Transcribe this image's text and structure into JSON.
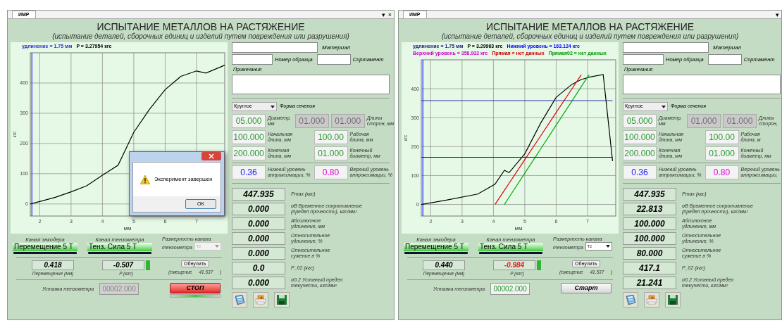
{
  "windows": [
    {
      "tab": "ИМР",
      "tab_buttons": [
        "▾",
        "×"
      ],
      "title": "ИСПЫТАНИЕ МЕТАЛЛОВ НА РАСТЯЖЕНИЕ",
      "subtitle": "(испытание деталей, сборочных единиц и изделий путем повреждения или разрушения)",
      "chart": {
        "legend_rows": [
          {
            "items": [
              {
                "text": "удлинение = 1.75 мм",
                "color": "#3030d0"
              },
              {
                "text": "P = 3.27954 кгс",
                "color": "#000000"
              }
            ]
          }
        ],
        "chart_data": {
          "type": "line",
          "xlabel": "мм",
          "ylabel": "кгс",
          "xlim": [
            1.7,
            7.9
          ],
          "ylim": [
            -40,
            500
          ],
          "xticks": [
            2,
            3,
            4,
            5,
            6,
            7
          ],
          "yticks": [
            0,
            100,
            200,
            300,
            400
          ],
          "x": [
            1.7,
            2,
            2.5,
            3,
            3.5,
            4,
            4.5,
            5,
            5.5,
            6,
            6.5,
            7,
            7.3,
            7.9
          ],
          "grid": true,
          "ref_lines": [
            {
              "axis": "x",
              "value": 1.75,
              "color": "#2020ff"
            }
          ],
          "series": [
            {
              "color": "#000000",
              "values": [
                0,
                8,
                22,
                40,
                60,
                95,
                128,
                237,
                313,
                378,
                422,
                440,
                433,
                459
              ]
            }
          ]
        },
        "dialog": {
          "message": "Эксперимент завершен",
          "button": "OK"
        }
      },
      "form": {
        "material_label": "Материал",
        "sample_label": "Номер образца",
        "sortament_label": "Сортамент",
        "notes_label": "Примечания",
        "section_value": "Круглое",
        "section_label": "Форма сечения",
        "params": [
          {
            "items": [
              {
                "kind": "field",
                "value": "05.000",
                "color": "#22992a",
                "disabled": false
              },
              {
                "kind": "label",
                "lines": [
                  "Диаметр,",
                  "мм"
                ]
              },
              {
                "kind": "field",
                "value": "01.000",
                "disabled": true
              },
              {
                "kind": "field",
                "value": "01.000",
                "disabled": true
              },
              {
                "kind": "label",
                "lines": [
                  "Длины",
                  "сторон, мм"
                ]
              }
            ]
          },
          {
            "items": [
              {
                "kind": "field",
                "value": "100.000",
                "color": "#22992a",
                "disabled": false
              },
              {
                "kind": "label",
                "lines": [
                  "Начальная",
                  "длина, мм"
                ]
              },
              {
                "kind": "field",
                "value": "100.00",
                "color": "#22992a",
                "disabled": false
              },
              {
                "kind": "label",
                "lines": [
                  "Рабочая",
                  "длина, мм"
                ]
              }
            ]
          },
          {
            "items": [
              {
                "kind": "field",
                "value": "200.000",
                "color": "#22992a",
                "disabled": false
              },
              {
                "kind": "label",
                "lines": [
                  "Конечная",
                  "длина, мм"
                ]
              },
              {
                "kind": "field",
                "value": "01.000",
                "color": "#22992a",
                "disabled": false
              },
              {
                "kind": "label",
                "lines": [
                  "Конечный",
                  "диаметр, мм"
                ]
              }
            ]
          },
          {
            "items": [
              {
                "kind": "field",
                "value": "0.36",
                "color": "#1a1aff",
                "disabled": false
              },
              {
                "kind": "label",
                "lines": [
                  "Нижний уровень",
                  "аппроксимации, %"
                ]
              },
              {
                "kind": "field",
                "value": "0.80",
                "color": "#dd00dd",
                "disabled": false
              },
              {
                "kind": "label",
                "lines": [
                  "Верхний уровень",
                  "аппроксимации, %"
                ]
              }
            ]
          }
        ]
      },
      "results": [
        {
          "value": "447.935",
          "lines": [
            "Pmax (кгс)"
          ]
        },
        {
          "value": "0.000",
          "lines": [
            "σB Временное сопротивление",
            "(предел прочности), кгс/мм²"
          ]
        },
        {
          "value": "0.000",
          "lines": [
            "Абсолютное",
            "удлинение, мм"
          ]
        },
        {
          "value": "0.000",
          "lines": [
            "Относительное",
            "удлинение, %"
          ]
        },
        {
          "value": "0.000",
          "lines": [
            "Относительное",
            "сужение в %"
          ]
        },
        {
          "value": "0.0",
          "lines": [
            "P_02 (кгс)"
          ]
        },
        {
          "value": "0.000",
          "lines": [
            "σ0.2 Условный предел",
            "текучести, кгс/мм²"
          ]
        }
      ],
      "channels": {
        "encoder": {
          "caption": "Канал энкодера",
          "value": "Перемещение 5 Т"
        },
        "tenzo": {
          "caption": "Канал тензометра",
          "value": "Тенз. Сила 5 Т"
        },
        "dimension": {
          "lines": [
            "Размерность канала",
            "тензометра"
          ],
          "value": "тс",
          "disabled": true
        }
      },
      "readings": {
        "displacement": {
          "value": "0.418",
          "label": "Перемещение (мм)"
        },
        "force": {
          "value": "-0.507",
          "label": "P (кгс)",
          "highlighted": false
        },
        "reset_button": "Обнулить",
        "offset_label": "(смещение",
        "offset_value": "41.537",
        "offset_close": ")"
      },
      "setpoint": {
        "label": "Уставка тензометра",
        "value": "00002.000",
        "disabled": true
      },
      "action": {
        "label": "СТОП",
        "kind": "stop",
        "busy": true
      }
    },
    {
      "tab": "ИМР",
      "tab_buttons": [
        "▾"
      ],
      "title": "ИСПЫТАНИЕ МЕТАЛЛОВ НА РАСТЯЖЕНИЕ",
      "subtitle": "(испытание деталей, сборочных единиц и изделий путем повреждения или разрушения)",
      "chart": {
        "legend_rows": [
          {
            "items": [
              {
                "text": "удлинение = 1.75 мм",
                "color": "#202080"
              },
              {
                "text": "P = 3.29963 кгс",
                "color": "#000000"
              },
              {
                "text": "Нижний уровень = 163.124 кгс",
                "color": "#0000ff"
              }
            ]
          },
          {
            "items": [
              {
                "text": "Верхний уровень = 358.932 кгс",
                "color": "#cc00cc"
              },
              {
                "text": "Прямая = нет данных",
                "color": "#cc0000"
              },
              {
                "text": "Прямая02 = нет данных",
                "color": "#009900"
              }
            ]
          }
        ],
        "chart_data": {
          "type": "line",
          "xlabel": "мм",
          "ylabel": "кгс",
          "xlim": [
            1.7,
            7.9
          ],
          "ylim": [
            -40,
            500
          ],
          "xticks": [
            2,
            3,
            4,
            5,
            6,
            7
          ],
          "yticks": [
            0,
            100,
            200,
            300,
            400
          ],
          "x": [
            1.7,
            2.5,
            3.5,
            4.05,
            4.35,
            4.5,
            5,
            5.5,
            6,
            6.5,
            6.8,
            7,
            7.05,
            7.5,
            7.8
          ],
          "grid": true,
          "ref_lines": [
            {
              "axis": "x",
              "value": 1.75,
              "color": "#2020ff"
            }
          ],
          "series": [
            {
              "color": "#000000",
              "values": [
                0,
                15,
                36,
                70,
                118,
                110,
                175,
                280,
                370,
                415,
                432,
                438,
                440,
                449,
                150
              ]
            },
            {
              "color": "#dd0000",
              "values": [
                null,
                null,
                null,
                0,
                49,
                73,
                155,
                236,
                318,
                399,
                448,
                null,
                null,
                null,
                null
              ]
            },
            {
              "color": "#00aa00",
              "values": [
                null,
                null,
                null,
                null,
                0,
                25,
                108,
                191,
                274,
                357,
                407,
                440,
                448,
                null,
                null
              ]
            },
            {
              "color": "#0000ff",
              "values": [
                163,
                163,
                163,
                163,
                163,
                163,
                163,
                163,
                163,
                163,
                163,
                163,
                163,
                163,
                163
              ]
            },
            {
              "color": "#333399",
              "values": [
                359,
                359,
                359,
                359,
                359,
                359,
                359,
                359,
                359,
                359,
                359,
                359,
                359,
                359,
                359
              ]
            }
          ]
        }
      },
      "form": {
        "material_label": "Материал",
        "sample_label": "Номер образца",
        "sortament_label": "Сортамент",
        "notes_label": "Примечания",
        "section_value": "Круглое",
        "section_label": "Форма сечения",
        "params": [
          {
            "items": [
              {
                "kind": "field",
                "value": "05.000",
                "color": "#22992a",
                "disabled": false
              },
              {
                "kind": "label",
                "lines": [
                  "Диаметр,",
                  "мм"
                ]
              },
              {
                "kind": "field",
                "value": "01.000",
                "disabled": true
              },
              {
                "kind": "field",
                "value": "01.000",
                "disabled": true
              },
              {
                "kind": "label",
                "lines": [
                  "Длины",
                  "сторон,"
                ]
              }
            ]
          },
          {
            "items": [
              {
                "kind": "field",
                "value": "100.000",
                "color": "#22992a",
                "disabled": false
              },
              {
                "kind": "label",
                "lines": [
                  "Начальная",
                  "длина, мм"
                ]
              },
              {
                "kind": "field",
                "value": "100.00",
                "color": "#22992a",
                "disabled": false
              },
              {
                "kind": "label",
                "lines": [
                  "Рабочая",
                  "длина, м"
                ]
              }
            ]
          },
          {
            "items": [
              {
                "kind": "field",
                "value": "200.000",
                "color": "#22992a",
                "disabled": false
              },
              {
                "kind": "label",
                "lines": [
                  "Конечная",
                  "длина, мм"
                ]
              },
              {
                "kind": "field",
                "value": "01.000",
                "color": "#22992a",
                "disabled": false
              },
              {
                "kind": "label",
                "lines": [
                  "Конечный",
                  "диаметр, мм"
                ]
              }
            ]
          },
          {
            "items": [
              {
                "kind": "field",
                "value": "0.36",
                "color": "#1a1aff",
                "disabled": false
              },
              {
                "kind": "label",
                "lines": [
                  "Нижний уровень",
                  "аппроксимации, %"
                ]
              },
              {
                "kind": "field",
                "value": "0.80",
                "color": "#dd00dd",
                "disabled": false
              },
              {
                "kind": "label",
                "lines": [
                  "Верхний уровень",
                  "аппроксимации,"
                ]
              }
            ]
          }
        ]
      },
      "results": [
        {
          "value": "447.935",
          "lines": [
            "Pmax (кгс)"
          ]
        },
        {
          "value": "22.813",
          "lines": [
            "σB Временное сопротивление",
            "(предел прочности), кгс/мм²"
          ]
        },
        {
          "value": "100.000",
          "lines": [
            "Абсолютное",
            "удлинение, мм"
          ]
        },
        {
          "value": "100.000",
          "lines": [
            "Относительное",
            "удлинение, %"
          ]
        },
        {
          "value": "80.000",
          "lines": [
            "Относительное",
            "сужение в %"
          ]
        },
        {
          "value": "417.1",
          "lines": [
            "P_02 (кгс)"
          ]
        },
        {
          "value": "21.241",
          "lines": [
            "σ0.2 Условный предел",
            "текучести, кгс/мм²"
          ]
        }
      ],
      "channels": {
        "encoder": {
          "caption": "Канал энкодера",
          "value": "Перемещение 5 Т"
        },
        "tenzo": {
          "caption": "Канал тензометра",
          "value": "Тенз. Сила 5 Т"
        },
        "dimension": {
          "lines": [
            "Размерность канала",
            "тензометра"
          ],
          "value": "тс",
          "disabled": false
        }
      },
      "readings": {
        "displacement": {
          "value": "0.440",
          "label": "Перемещение (мм)"
        },
        "force": {
          "value": "-0.984",
          "label": "P (кгс)",
          "highlighted": true
        },
        "reset_button": "Обнулить",
        "offset_label": "(смещение",
        "offset_value": "41.537",
        "offset_close": ")"
      },
      "setpoint": {
        "label": "Уставка тензометра",
        "value": "00002.000",
        "disabled": false
      },
      "action": {
        "label": "Старт",
        "kind": "start",
        "busy": false
      }
    }
  ]
}
